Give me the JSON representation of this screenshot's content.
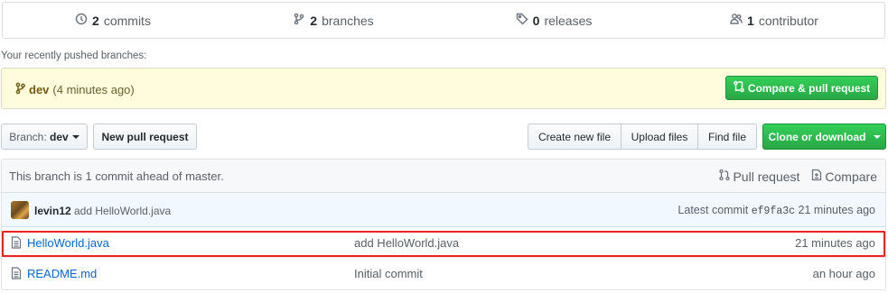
{
  "numbers_summary": {
    "commits": {
      "count": "2",
      "label": "commits"
    },
    "branches": {
      "count": "2",
      "label": "branches"
    },
    "releases": {
      "count": "0",
      "label": "releases"
    },
    "contributors": {
      "count": "1",
      "label": "contributor"
    }
  },
  "recent_branches": {
    "label": "Your recently pushed branches:",
    "branch_name": "dev",
    "time": "(4 minutes ago)",
    "compare_button": "Compare & pull request"
  },
  "toolbar": {
    "branch_prefix": "Branch:",
    "branch_value": "dev",
    "new_pull_request": "New pull request",
    "create_new_file": "Create new file",
    "upload_files": "Upload files",
    "find_file": "Find file",
    "clone_download": "Clone or download"
  },
  "branch_info": {
    "message": "This branch is 1 commit ahead of master.",
    "pull_request": "Pull request",
    "compare": "Compare"
  },
  "latest_commit": {
    "author": "levin12",
    "message": "add HelloWorld.java",
    "prefix": "Latest commit",
    "sha": "ef9fa3c",
    "time": "21 minutes ago"
  },
  "files": [
    {
      "name": "HelloWorld.java",
      "message": "add HelloWorld.java",
      "age": "21 minutes ago",
      "icon": "file-icon"
    },
    {
      "name": "README.md",
      "message": "Initial commit",
      "age": "an hour ago",
      "icon": "file-icon"
    }
  ],
  "colors": {
    "accent_green": "#28a745",
    "link_blue": "#0366d6",
    "highlight_red": "#ee2222",
    "recent_bg": "#fffbdd"
  }
}
